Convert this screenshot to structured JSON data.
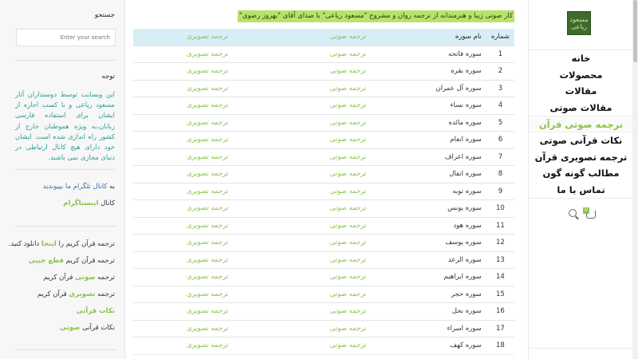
{
  "nav": {
    "logo_text": "مسعود ریاعی",
    "items": [
      {
        "label": "خانه",
        "active": false
      },
      {
        "label": "محصولات",
        "active": false
      },
      {
        "label": "مقالات",
        "active": false
      },
      {
        "label": "مقالات صوتی",
        "active": false
      },
      {
        "label": "ترجمه صوتی قرآن",
        "active": true
      },
      {
        "label": "نکات قرآنی صوتی",
        "active": false
      },
      {
        "label": "ترجمه تصویری قرآن",
        "active": false
      },
      {
        "label": "مطالب گونه گون",
        "active": false
      },
      {
        "label": "تماس با ما",
        "active": false
      }
    ],
    "cart_count": "0",
    "icons": [
      "search-icon",
      "cart-icon"
    ]
  },
  "main": {
    "intro": "کار صوتی زیبا و هنرمندانه از ترجمه روان و مشروح \"مسعود ریاعی\" با صدای آقای \"بهروز رضوی\"",
    "table": {
      "headers": {
        "num": "شماره",
        "name": "نام سوره",
        "audio": "ترجمه صوتی",
        "image": "ترجمه تصویری"
      },
      "rows": [
        {
          "num": "1",
          "name": "سوره فاتحه",
          "audio": "ترجمه صوتی",
          "image": "ترجمه تصویری"
        },
        {
          "num": "2",
          "name": "سوره بقره",
          "audio": "ترجمه صوتی",
          "image": "ترجمه تصویری"
        },
        {
          "num": "3",
          "name": "سوره آل عمران",
          "audio": "ترجمه صوتی",
          "image": "ترجمه تصویری"
        },
        {
          "num": "4",
          "name": "سوره نساء",
          "audio": "ترجمه صوتی",
          "image": "ترجمه تصویری"
        },
        {
          "num": "5",
          "name": "سوره مائده",
          "audio": "ترجمه صوتی",
          "image": "ترجمه تصویری"
        },
        {
          "num": "6",
          "name": "سوره انعام",
          "audio": "ترجمه صوتی",
          "image": "ترجمه تصویری"
        },
        {
          "num": "7",
          "name": "سوره اعراف",
          "audio": "ترجمه صوتی",
          "image": "ترجمه تصویری"
        },
        {
          "num": "8",
          "name": "سوره انفال",
          "audio": "ترجمه صوتی",
          "image": "ترجمه تصویری"
        },
        {
          "num": "9",
          "name": "سوره توبه",
          "audio": "ترجمه صوتی",
          "image": "ترجمه تصویری"
        },
        {
          "num": "10",
          "name": "سوره یونس",
          "audio": "ترجمه صوتی",
          "image": "ترجمه تصویری"
        },
        {
          "num": "11",
          "name": "سوره هود",
          "audio": "ترجمه صوتی",
          "image": "ترجمه تصویری"
        },
        {
          "num": "12",
          "name": "سوره یوسف",
          "audio": "ترجمه صوتی",
          "image": "ترجمه تصویری"
        },
        {
          "num": "13",
          "name": "سوره الرعد",
          "audio": "ترجمه صوتی",
          "image": "ترجمه تصویری"
        },
        {
          "num": "14",
          "name": "سوره ابراهیم",
          "audio": "ترجمه صوتی",
          "image": "ترجمه تصویری"
        },
        {
          "num": "15",
          "name": "سوره حجر",
          "audio": "ترجمه صوتی",
          "image": "ترجمه تصویری"
        },
        {
          "num": "16",
          "name": "سوره نحل",
          "audio": "ترجمه صوتی",
          "image": "ترجمه تصویری"
        },
        {
          "num": "17",
          "name": "سوره اسراء",
          "audio": "ترجمه صوتی",
          "image": "ترجمه تصویری"
        },
        {
          "num": "18",
          "name": "سوره کهف",
          "audio": "ترجمه صوتی",
          "image": "ترجمه تصویری"
        }
      ]
    }
  },
  "sidebar": {
    "search_title": "جستجو",
    "search_placeholder": "Enter your search",
    "notice_title": "توجه",
    "notice_text": "این وبسایت توسط دوستداران آثار مسعود ریاعی و با کسب اجازه از ایشان برای استفاده فارسی زبانان،به ویژه هموطنان خارج از کشور راه اندازی شده است. ایشان خود دارای هیچ کانال ارتباطی در دنیای مجازی نمی باشند.",
    "telegram": {
      "pre": "به ",
      "link": "کانال تلگرام",
      "post": " ما بپیوندید"
    },
    "instagram": {
      "pre": "کانال ",
      "link": "اینستاگرام"
    },
    "download": {
      "pre": "ترجمه قرآن کریم را ",
      "link": "اینجا",
      "post": " دانلود کنید."
    },
    "pocket": {
      "pre": "ترجمه قرآن کریم ",
      "link": "قطع جیبی"
    },
    "audio": {
      "pre": "ترجمه ",
      "link": "صوتی",
      "post": " قرآن کریم"
    },
    "image": {
      "pre": "ترجمه ",
      "link": "تصویری",
      "post": " قرآن کریم"
    },
    "notes": {
      "link": "نکات قرآنی"
    },
    "notes_audio": {
      "pre": "نکات قرآنی ",
      "link": "صوتی"
    }
  },
  "colors": {
    "accent": "#8bc34a",
    "teal": "#2a9d8f",
    "header_bg": "#d9edf7",
    "intro_bg": "#b9e26b"
  }
}
